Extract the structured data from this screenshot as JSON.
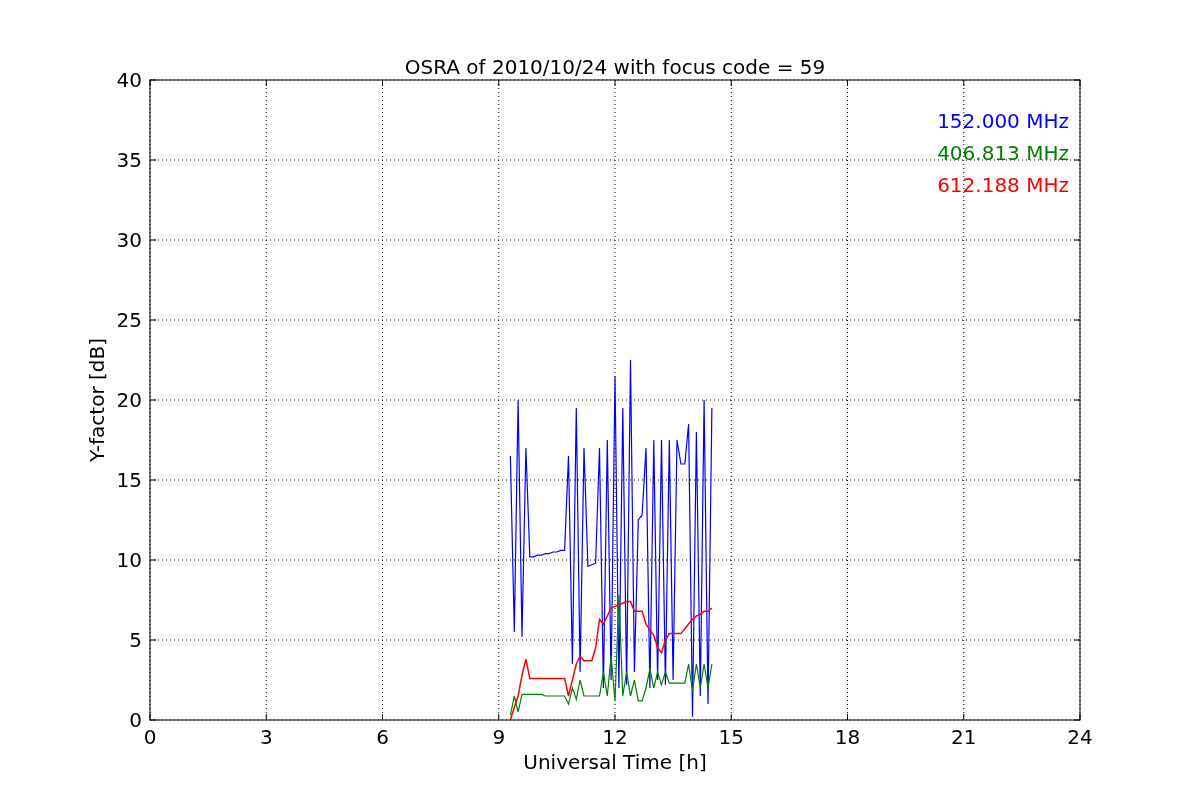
{
  "figure": {
    "chart_data": {
      "type": "line",
      "title": "OSRA of 2010/10/24 with focus code = 59",
      "xlabel": "Universal Time [h]",
      "ylabel": "Y-factor [dB]",
      "xlim": [
        0,
        24
      ],
      "ylim": [
        0,
        40
      ],
      "xticks": [
        0,
        3,
        6,
        9,
        12,
        15,
        18,
        21,
        24
      ],
      "yticks": [
        0,
        5,
        10,
        15,
        20,
        25,
        30,
        35,
        40
      ],
      "grid": true,
      "x": [
        9.3,
        9.4,
        9.5,
        9.6,
        9.7,
        9.8,
        9.9,
        10.0,
        10.1,
        10.2,
        10.3,
        10.4,
        10.5,
        10.6,
        10.7,
        10.8,
        10.9,
        11.0,
        11.1,
        11.2,
        11.3,
        11.4,
        11.5,
        11.6,
        11.7,
        11.8,
        11.9,
        12.0,
        12.1,
        12.2,
        12.3,
        12.4,
        12.5,
        12.6,
        12.7,
        12.8,
        12.9,
        13.0,
        13.1,
        13.2,
        13.3,
        13.4,
        13.5,
        13.6,
        13.7,
        13.8,
        13.9,
        14.0,
        14.1,
        14.2,
        14.3,
        14.4,
        14.5
      ],
      "series": [
        {
          "name": "152.000 MHz",
          "color": "#0000ff",
          "values": [
            16.5,
            5.5,
            20,
            5.2,
            17,
            10.2,
            10.2,
            10.3,
            10.3,
            10.4,
            10.4,
            10.5,
            10.5,
            10.6,
            10.6,
            16.5,
            3.5,
            19.5,
            3,
            17,
            9.6,
            9.7,
            9.8,
            17,
            2,
            17.5,
            2.5,
            21.5,
            2,
            19.5,
            2.2,
            22.5,
            3,
            12.5,
            12.8,
            17,
            2,
            17.5,
            2.5,
            17.5,
            2.2,
            17.5,
            2.5,
            17.5,
            16,
            16,
            18.5,
            0.2,
            18,
            1.5,
            20,
            1,
            19.5
          ]
        },
        {
          "name": "406.813 MHz",
          "color": "#008000",
          "values": [
            0.3,
            1.5,
            0.5,
            1.6,
            1.6,
            1.6,
            1.6,
            1.6,
            1.6,
            1.5,
            1.5,
            1.5,
            1.5,
            1.5,
            1.5,
            1,
            2,
            1.3,
            2.5,
            1.5,
            1.5,
            1.5,
            1.5,
            1.5,
            3,
            1.5,
            4,
            1.2,
            7.8,
            1.5,
            3,
            1.5,
            2.5,
            1.2,
            1.2,
            2,
            3.2,
            2,
            3,
            2.2,
            3,
            2.3,
            2.3,
            2.3,
            2.3,
            2.3,
            3.5,
            1.8,
            3.5,
            2,
            3.5,
            2,
            3.5
          ]
        },
        {
          "name": "612.188 MHz",
          "color": "#ff0000",
          "values": [
            0,
            0.8,
            1.5,
            2.8,
            3.8,
            2.6,
            2.6,
            2.6,
            2.6,
            2.6,
            2.6,
            2.6,
            2.6,
            2.6,
            2.6,
            1.5,
            2.5,
            3.5,
            4,
            3.7,
            3.7,
            3.7,
            4.5,
            6.3,
            6,
            6.5,
            7,
            7.1,
            7.2,
            7.3,
            7.4,
            7.4,
            6.8,
            6.8,
            6.8,
            6,
            5.6,
            5.3,
            4.5,
            4.2,
            5,
            5.4,
            5.4,
            5.4,
            5.4,
            5.7,
            6,
            6.3,
            6.5,
            6.6,
            6.8,
            6.8,
            7
          ]
        }
      ]
    }
  }
}
